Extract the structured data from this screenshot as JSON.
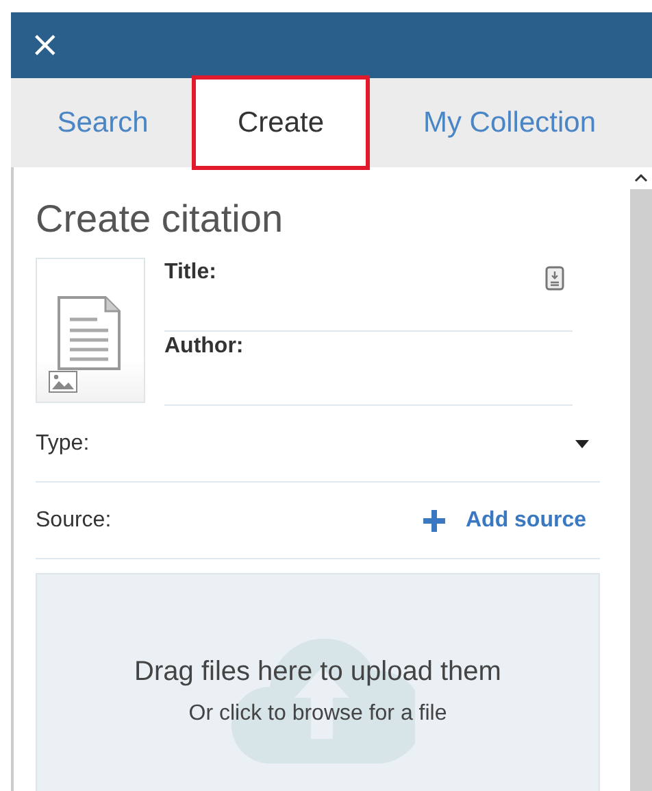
{
  "header": {
    "close_label": "×"
  },
  "tabs": [
    {
      "label": "Search",
      "selected": false,
      "highlighted": false
    },
    {
      "label": "Create",
      "selected": true,
      "highlighted": true
    },
    {
      "label": "My Collection",
      "selected": false,
      "highlighted": false
    }
  ],
  "heading": "Create citation",
  "fields": [
    {
      "label": "Title:",
      "kind": "text-with-icon"
    },
    {
      "label": "Author:",
      "kind": "text"
    }
  ],
  "type_field": {
    "label": "Type:"
  },
  "source_field": {
    "label": "Source:",
    "action": "Add source"
  },
  "dropzone": {
    "title": "Drag files here to upload them",
    "subtitle": "Or click to browse for a file"
  }
}
